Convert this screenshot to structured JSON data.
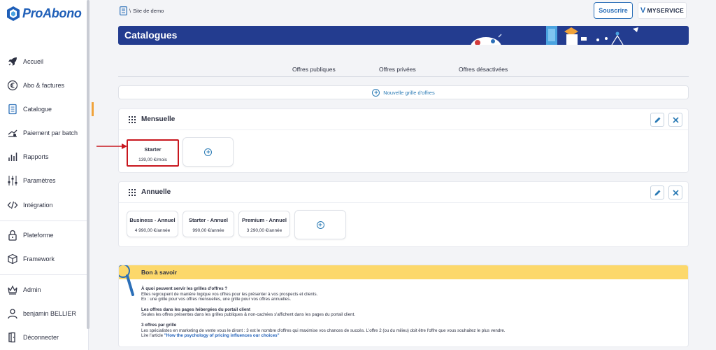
{
  "app": {
    "logo_text": "ProAbono"
  },
  "sidebar": {
    "items": [
      {
        "label": "Accueil",
        "icon": "rocket-icon"
      },
      {
        "label": "Abo & factures",
        "icon": "euro-icon"
      },
      {
        "label": "Catalogue",
        "icon": "catalog-icon",
        "active": true
      },
      {
        "label": "Paiement par batch",
        "icon": "batch-payment-icon"
      },
      {
        "label": "Rapports",
        "icon": "reports-icon"
      },
      {
        "label": "Paramètres",
        "icon": "settings-sliders-icon"
      },
      {
        "label": "Intégration",
        "icon": "code-icon"
      },
      {
        "label": "Plateforme",
        "icon": "lock-icon"
      },
      {
        "label": "Framework",
        "icon": "box-icon"
      },
      {
        "label": "Admin",
        "icon": "crown-icon"
      },
      {
        "label": "benjamin BELLIER",
        "icon": "user-icon"
      },
      {
        "label": "Déconnecter",
        "icon": "logout-icon"
      }
    ]
  },
  "header": {
    "breadcrumb_sep": "\\",
    "breadcrumb": "Site de demo",
    "subscribe_label": "Souscrire",
    "brand_badge": "MYSERVICE",
    "brand_badge_mark": "V"
  },
  "banner": {
    "title": "Catalogues"
  },
  "tabs": [
    {
      "label": "Offres publiques"
    },
    {
      "label": "Offres privées"
    },
    {
      "label": "Offres désactivées"
    }
  ],
  "new_grid": {
    "label": "Nouvelle grille d'offres"
  },
  "grids": [
    {
      "title": "Mensuelle",
      "offers": [
        {
          "name": "Starter",
          "price": "139,00 €/mois",
          "highlighted": true
        }
      ]
    },
    {
      "title": "Annuelle",
      "offers": [
        {
          "name": "Business - Annuel",
          "price": "4 990,00 €/année"
        },
        {
          "name": "Starter - Annuel",
          "price": "990,00 €/année"
        },
        {
          "name": "Premium - Annuel",
          "price": "3 290,00 €/année"
        }
      ]
    }
  ],
  "tips": {
    "title": "Bon à savoir",
    "sections": [
      {
        "question": "À quoi peuvent servir les grilles d'offres ?",
        "lines": [
          "Elles regroupent de manière logique vos offres pour les présenter à vos prospects et clients.",
          "Ex : une grille pour vos offres mensuelles, une grille pour vos offres annuelles."
        ]
      },
      {
        "question": "Les offres dans les pages hébergées du portail client",
        "lines": [
          "Seules les offres présentes dans les grilles publiques & non-cachées s'affichent dans les pages du portail client."
        ]
      },
      {
        "question": "3 offres par grille",
        "lines": [
          "Les spécialistes en marketing de vente vous le diront : 3 est le nombre d'offres qui maximise vos chances de succès. L'offre 2 (ou du milieu) doit être l'offre que vous souhaitez le plus vendre."
        ],
        "link_prefix": "Lire l'article ",
        "link_text": "\"How the psychology of pricing influences our choices\""
      }
    ]
  },
  "colors": {
    "brand_blue": "#1f5fb8",
    "banner_navy": "#233c8f",
    "tips_yellow": "#fcd86b",
    "highlight_red": "#c8161e",
    "active_marker": "#f0a33b"
  }
}
